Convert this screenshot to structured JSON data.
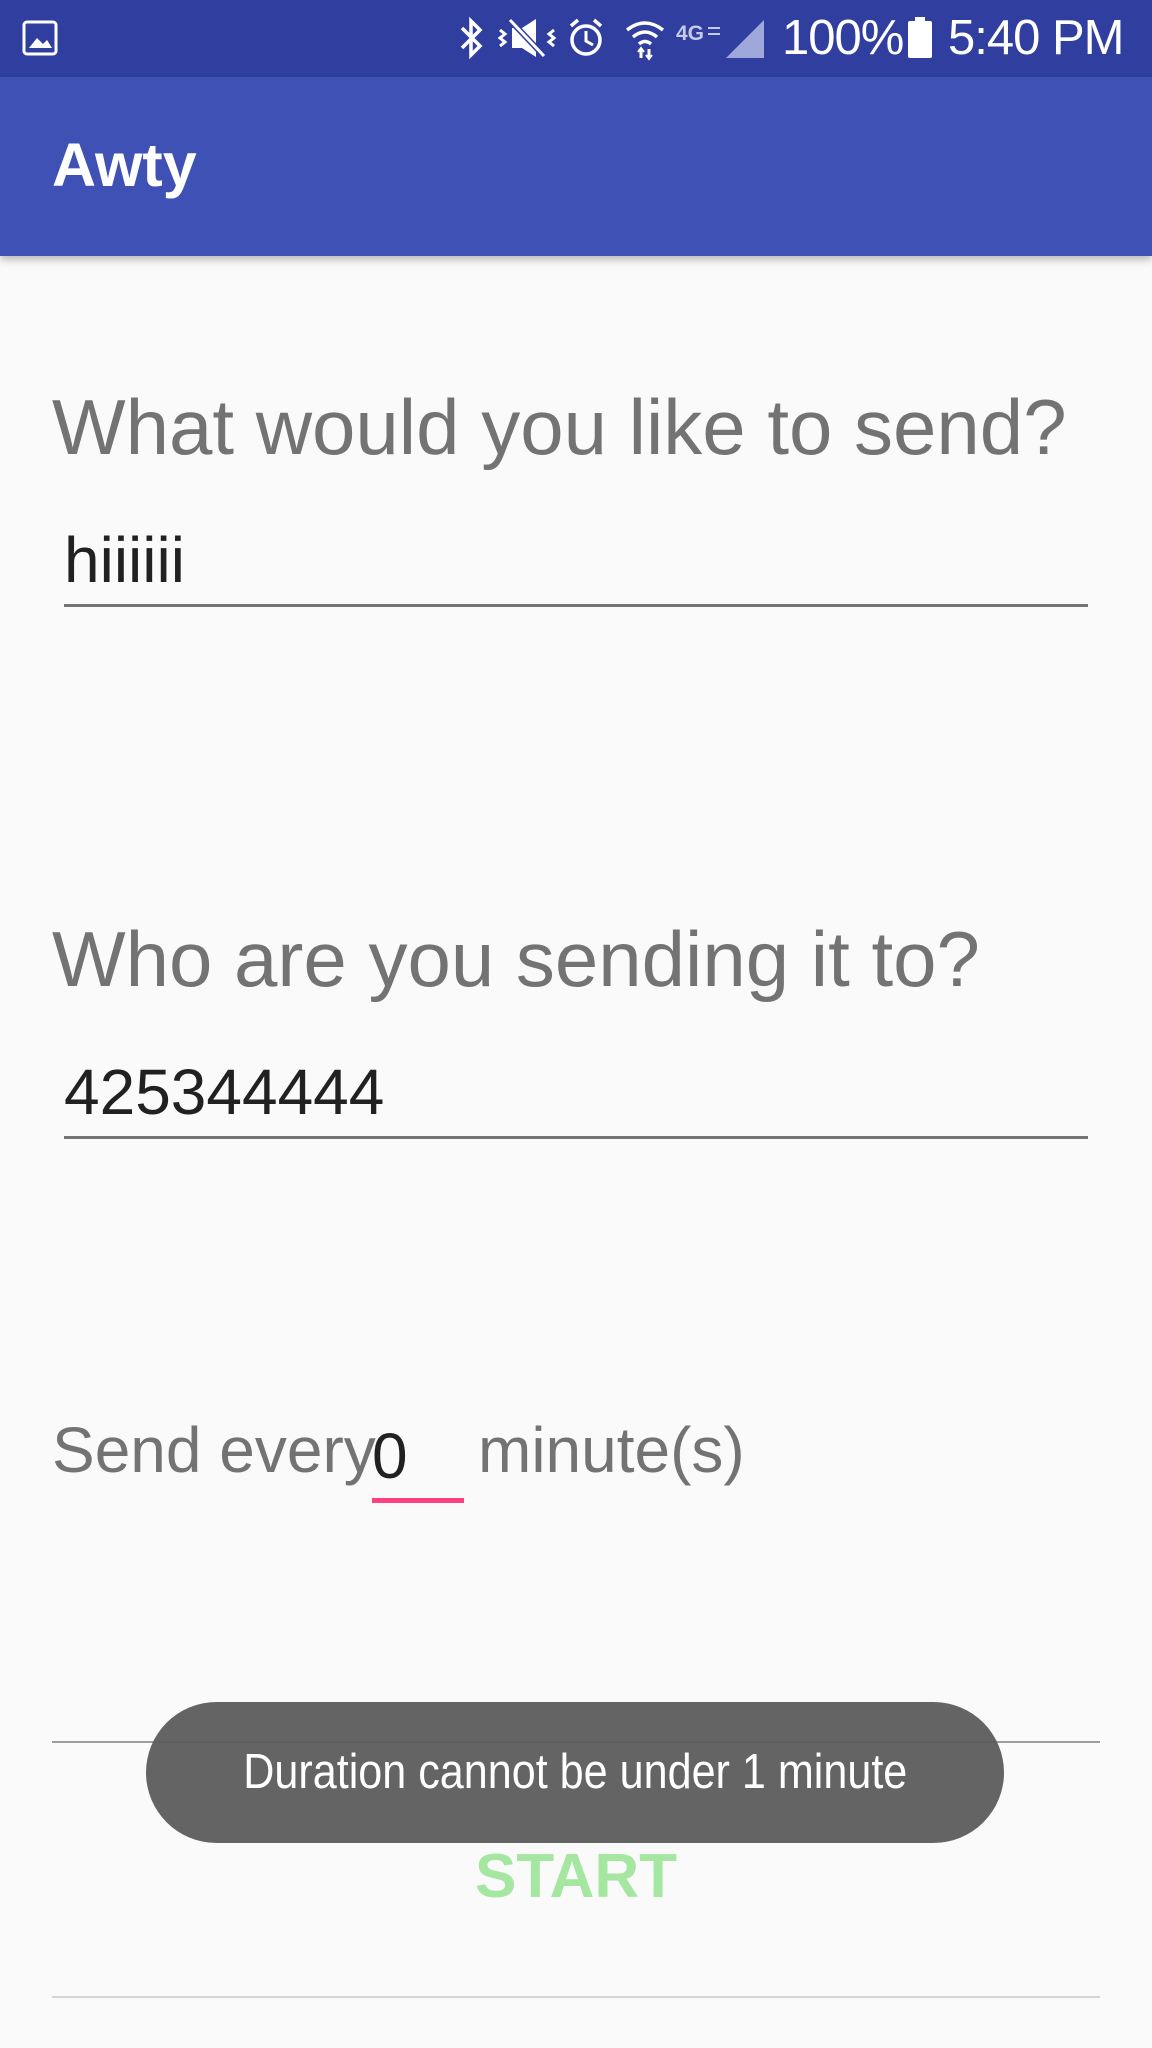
{
  "status_bar": {
    "battery_text": "100%",
    "time": "5:40 PM",
    "network_label": "4G",
    "icons": [
      "gallery-icon",
      "bluetooth-icon",
      "vibrate-icon",
      "alarm-icon",
      "wifi-icon",
      "lte-icon",
      "signal-icon",
      "battery-icon"
    ],
    "background": "#303f9f"
  },
  "app_bar": {
    "title": "Awty",
    "background": "#3f51b5"
  },
  "message_section": {
    "label": "What would you like to send?",
    "value": "hiiiiii"
  },
  "recipient_section": {
    "label": "Who are you sending it to?",
    "value": "425344444"
  },
  "interval_section": {
    "prefix": "Send every",
    "value": "0",
    "suffix": "minute(s)",
    "accent": "#ff4081"
  },
  "start_button": {
    "label": "START",
    "color": "#a5e6a0"
  },
  "toast": {
    "message": "Duration cannot be under 1 minute"
  }
}
